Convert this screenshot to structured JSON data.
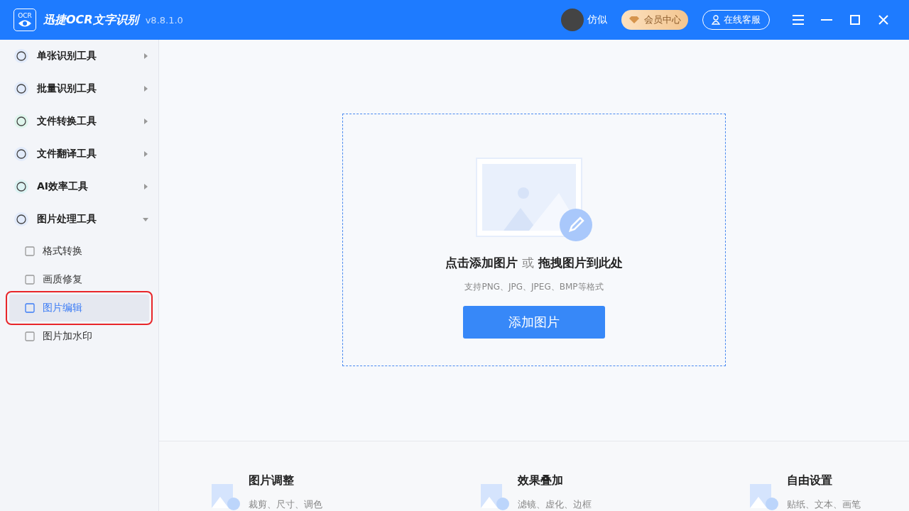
{
  "app": {
    "logo_text": "OCR",
    "title": "迅捷OCR文字识别",
    "version": "v8.8.1.0"
  },
  "header": {
    "user": "仿似",
    "vip": "会员中心",
    "service": "在线客服"
  },
  "sidebar": [
    {
      "label": "单张识别工具",
      "expanded": false
    },
    {
      "label": "批量识别工具",
      "expanded": false
    },
    {
      "label": "文件转换工具",
      "expanded": false
    },
    {
      "label": "文件翻译工具",
      "expanded": false
    },
    {
      "label": "AI效率工具",
      "expanded": false
    },
    {
      "label": "图片处理工具",
      "expanded": true,
      "children": [
        {
          "label": "格式转换",
          "selected": false,
          "highlighted": false
        },
        {
          "label": "画质修复",
          "selected": false,
          "highlighted": false
        },
        {
          "label": "图片编辑",
          "selected": true,
          "highlighted": true
        },
        {
          "label": "图片加水印",
          "selected": false,
          "highlighted": false
        }
      ]
    }
  ],
  "dropzone": {
    "action": "点击添加图片",
    "or": "或",
    "drag": "拖拽图片到此处",
    "hint": "支持PNG、JPG、JPEG、BMP等格式",
    "button": "添加图片"
  },
  "features": [
    {
      "title": "图片调整",
      "desc": "裁剪、尺寸、调色"
    },
    {
      "title": "效果叠加",
      "desc": "滤镜、虚化、边框"
    },
    {
      "title": "自由设置",
      "desc": "贴纸、文本、画笔"
    }
  ]
}
